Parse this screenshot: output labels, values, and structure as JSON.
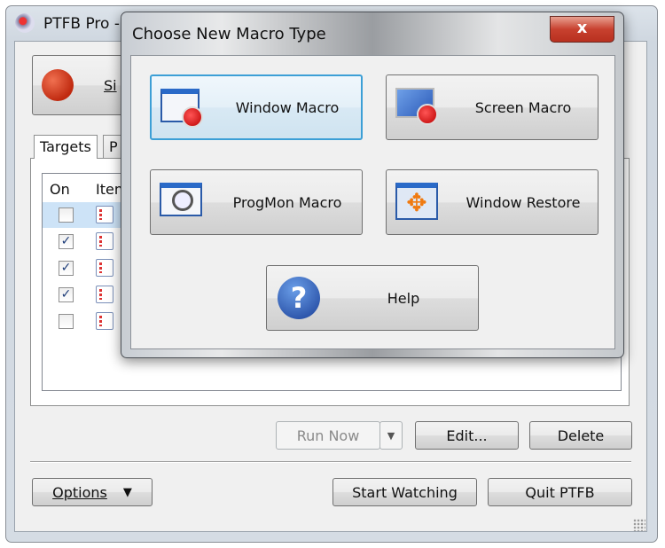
{
  "main_window": {
    "title": "PTFB Pro -",
    "big_button_label": "Si",
    "tabs": [
      {
        "label": "Targets"
      },
      {
        "label": "P"
      }
    ],
    "list": {
      "columns": [
        "On",
        "Item"
      ],
      "rows": [
        {
          "checked": false,
          "selected": true
        },
        {
          "checked": true
        },
        {
          "checked": true
        },
        {
          "checked": true
        },
        {
          "checked": false
        }
      ]
    },
    "check_glyph": "✓",
    "buttons": {
      "run_now": "Run Now",
      "edit": "Edit...",
      "delete": "Delete",
      "options": "Options",
      "start_watching": "Start Watching",
      "quit": "Quit PTFB"
    }
  },
  "dialog": {
    "title": "Choose New Macro Type",
    "close_glyph": "x",
    "buttons": {
      "window_macro": "Window Macro",
      "screen_macro": "Screen Macro",
      "progmon_macro": "ProgMon Macro",
      "window_restore": "Window Restore",
      "help": "Help"
    },
    "help_glyph": "?"
  },
  "colors": {
    "selection": "#cde3f7",
    "close_red": "#c8412f",
    "focus_border": "#3c9fd6"
  }
}
